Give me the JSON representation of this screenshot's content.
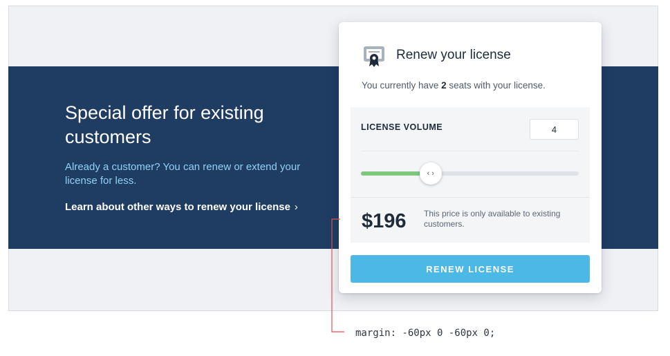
{
  "offer": {
    "title": "Special offer for existing customers",
    "subtitle": "Already a customer? You can renew or extend your license for less.",
    "link_label": "Learn about other ways to renew your license",
    "link_chevron": "›"
  },
  "card": {
    "icon": "certificate-icon",
    "title": "Renew your license",
    "desc_before": "You currently have ",
    "desc_seats": "2",
    "desc_after": " seats with your license.",
    "volume_label": "LICENSE VOLUME",
    "volume_value": "4",
    "slider_level": 0.32,
    "slider_thumb_icon": "left-right-arrows-icon",
    "price": "$196",
    "price_note": "This price is only available to existing customers.",
    "button_label": "RENEW LICENSE"
  },
  "annotation": {
    "text": "margin: -60px 0 -60px 0;"
  },
  "colors": {
    "band": "#1f3c63",
    "accent_blue": "#4bb8e6",
    "slider_green": "#7ec87e",
    "annotation_red": "#e05050"
  }
}
